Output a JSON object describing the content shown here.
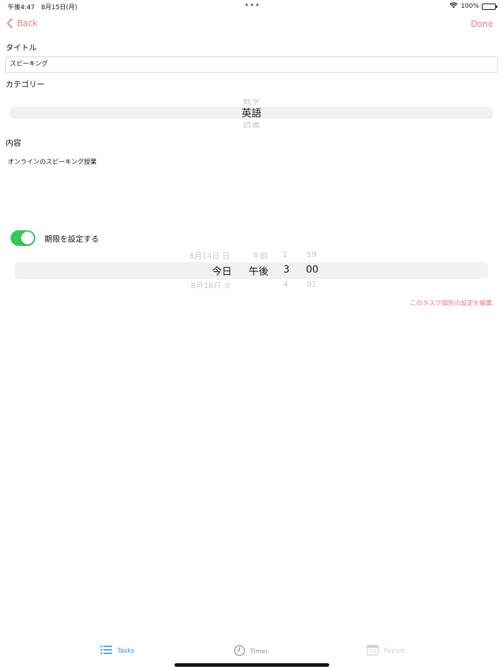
{
  "status_bar": {
    "time_date": "午後4:47　8月15日(月)",
    "battery": "100%",
    "icons": [
      "wifi-icon",
      "battery-icon"
    ]
  },
  "nav": {
    "back_label": "Back",
    "done_label": "Done",
    "accent_color": "#f07a7a"
  },
  "form": {
    "title_label": "タイトル",
    "title_value": "スピーキング",
    "category_label": "カテゴリー",
    "category_picker": {
      "above": "数学",
      "selected": "英語",
      "below": "読書"
    },
    "content_label": "内容",
    "content_value": "オンラインのスピーキング授業",
    "deadline_toggle_label": "期限を設定する",
    "deadline_toggle_on": true,
    "toggle_color": "#34c759",
    "date_picker": {
      "selected": {
        "day": "今日",
        "ampm": "午後",
        "hour": "3",
        "minute": "00"
      },
      "above": {
        "day": "8月14日 日",
        "ampm": "午前",
        "hour": "2",
        "minute": "59"
      },
      "below": {
        "day": "8月16日 火",
        "ampm": "",
        "hour": "4",
        "minute": "01"
      }
    },
    "edit_task_settings_link": "このタスク個別の設定を編集"
  },
  "tabs": [
    {
      "label": "Tasks",
      "icon": "list-icon",
      "active": true
    },
    {
      "label": "Timer",
      "icon": "clock-icon",
      "active": false
    },
    {
      "label": "Report",
      "icon": "calendar-icon",
      "active": false
    }
  ]
}
